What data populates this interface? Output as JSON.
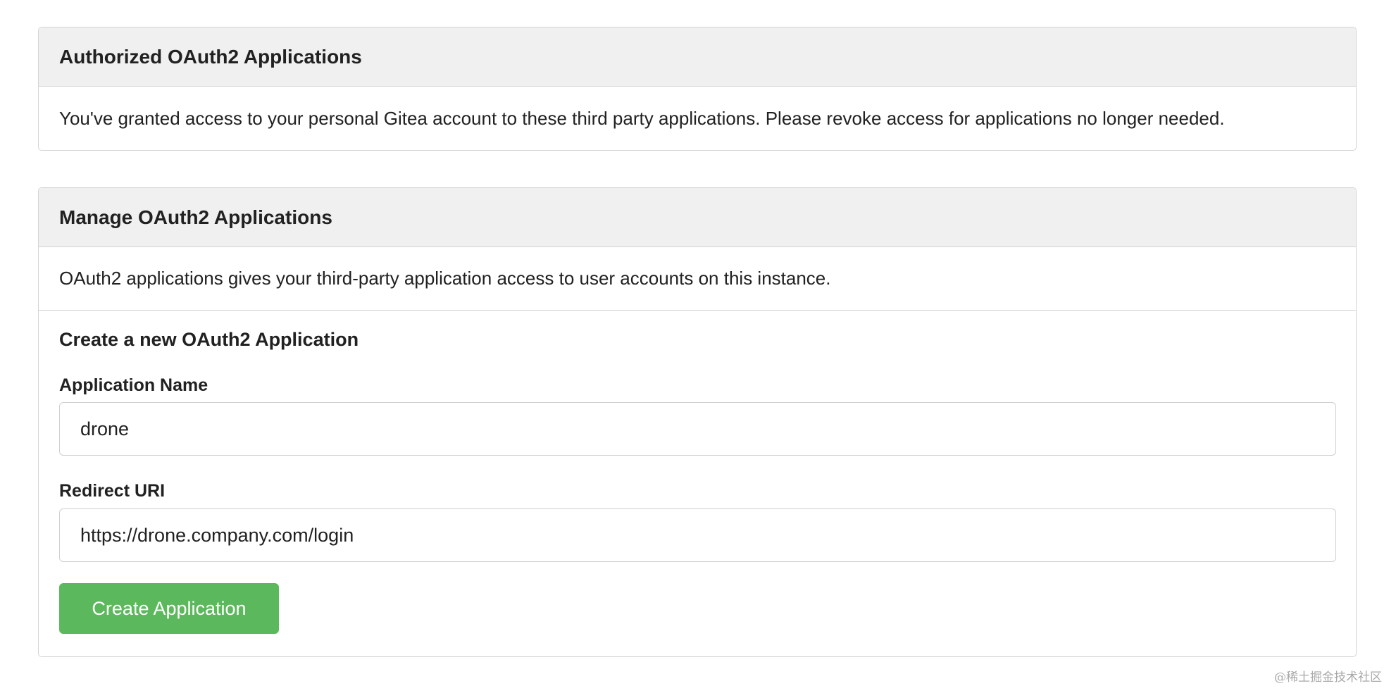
{
  "authorized": {
    "title": "Authorized OAuth2 Applications",
    "description": "You've granted access to your personal Gitea account to these third party applications. Please revoke access for applications no longer needed."
  },
  "manage": {
    "title": "Manage OAuth2 Applications",
    "description": "OAuth2 applications gives your third-party application access to user accounts on this instance.",
    "form": {
      "title": "Create a new OAuth2 Application",
      "app_name_label": "Application Name",
      "app_name_value": "drone",
      "redirect_label": "Redirect URI",
      "redirect_value": "https://drone.company.com/login",
      "submit_label": "Create Application"
    }
  },
  "watermark": "@稀土掘金技术社区",
  "colors": {
    "button": "#5cb85c",
    "header_bg": "#f0f0f0",
    "border": "#d4d4d5"
  }
}
